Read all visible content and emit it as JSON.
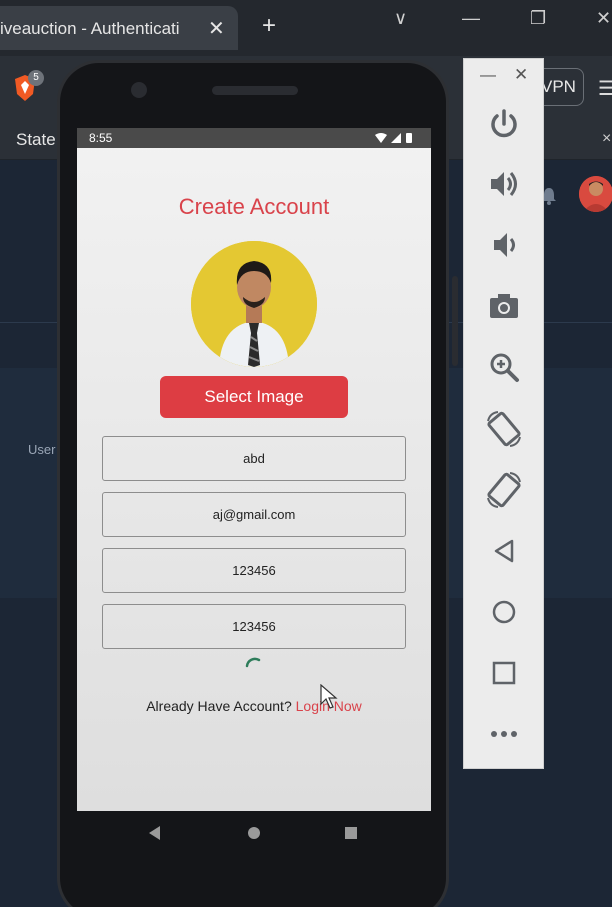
{
  "browser": {
    "tab_title": "iveauction - Authenticati",
    "tab_close": "✕",
    "new_tab": "+",
    "tab_badge": "5",
    "vpn_label": "VPN",
    "bookmark_label": "State",
    "bookmark_close": "×",
    "win_chevron": "∨",
    "win_minimize": "—",
    "win_restore": "❐",
    "win_close": "✕",
    "menu": "☰",
    "page_user_label": "User"
  },
  "emulator": {
    "minimize": "—",
    "close": "✕",
    "tools": [
      "power-icon",
      "volume-up-icon",
      "volume-down-icon",
      "camera-icon",
      "zoom-icon",
      "rotate-left-icon",
      "rotate-right-icon",
      "back-icon",
      "home-icon",
      "overview-icon",
      "more-icon"
    ]
  },
  "phone": {
    "status_time": "8:55",
    "title": "Create Account",
    "select_image_label": "Select Image",
    "fields": {
      "name": "abd",
      "email": "aj@gmail.com",
      "password": "123456",
      "confirm_password": "123456"
    },
    "login_prompt": "Already Have Account?",
    "login_link": "Login Now",
    "colors": {
      "accent": "#dd3d43",
      "profile_bg": "#e4c832"
    }
  }
}
